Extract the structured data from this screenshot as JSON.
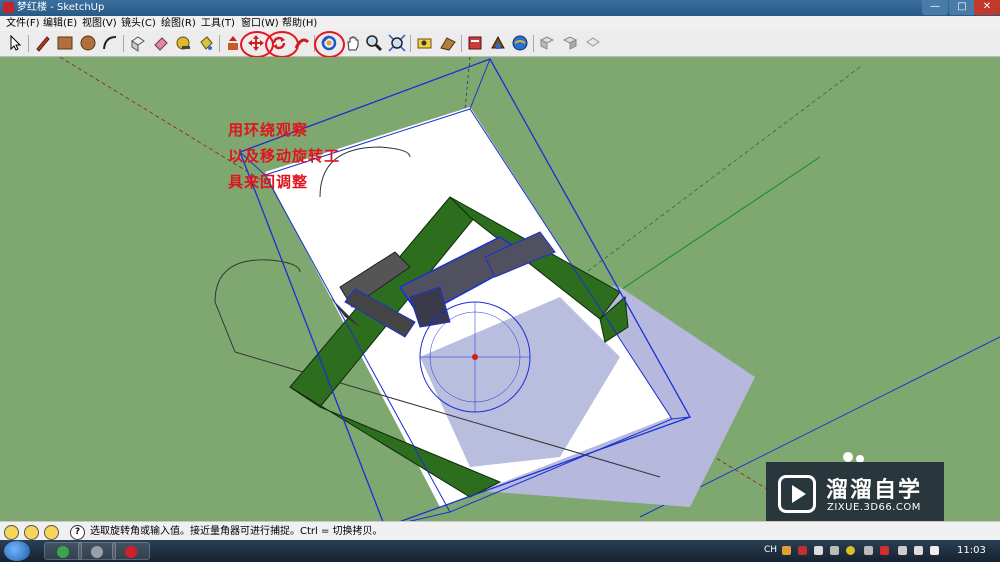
{
  "window": {
    "title": "梦红楼 - SketchUp",
    "minimize_label": "—",
    "maximize_label": "□",
    "close_label": "✕"
  },
  "menu": [
    "文件(F)",
    "编辑(E)",
    "视图(V)",
    "镜头(C)",
    "绘图(R)",
    "工具(T)",
    "窗口(W)",
    "帮助(H)"
  ],
  "toolbar": {
    "tools": [
      "select-icon",
      "pencil-icon",
      "rectangle-icon",
      "circle-icon",
      "arc-icon",
      "eraser-icon",
      "paint-bucket-icon",
      "push-pull-icon",
      "follow-me-icon",
      "move-icon",
      "rotate-icon",
      "offset-icon",
      "orbit-icon",
      "pan-icon",
      "zoom-icon",
      "zoom-extents-icon",
      "position-camera-icon",
      "walk-icon",
      "look-around-icon",
      "components-icon",
      "materials-icon",
      "get-models-icon",
      "section-icon"
    ],
    "highlighted": [
      "move-icon",
      "rotate-icon",
      "orbit-icon"
    ]
  },
  "annotation": {
    "line1": "用环绕观察",
    "line2": "以及移动旋转工",
    "line3": "具来回调整",
    "color": "#e0141e"
  },
  "statusbar": {
    "help_label": "?",
    "hint": "选取旋转角或输入值。接近量角器可进行捕捉。Ctrl = 切换拷贝。"
  },
  "watermark": {
    "title": "溜溜自学",
    "url": "ZIXUE.3D66.COM"
  },
  "taskbar": {
    "ime": "CH",
    "clock": "11:03"
  },
  "colors": {
    "ground": "#7ea870",
    "selection": "#1a2fd6",
    "highlight": "#e8141e",
    "wall": "#2d6e1e"
  }
}
